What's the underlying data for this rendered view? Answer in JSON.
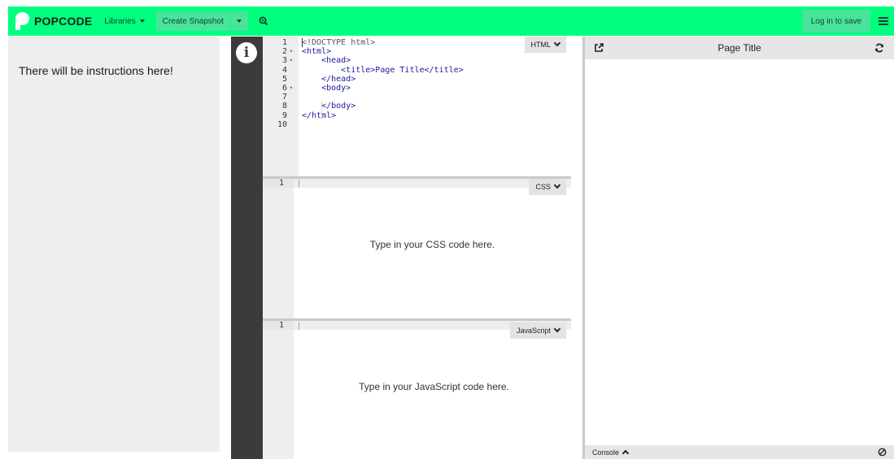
{
  "brand": {
    "name": "POPCODE",
    "accent": "#00ff7f"
  },
  "topbar": {
    "libraries_label": "Libraries",
    "snapshot_label": "Create Snapshot",
    "login_label": "Log in to save",
    "icons": [
      "chevron-down-icon",
      "search-icon",
      "hamburger-icon"
    ]
  },
  "instructions": {
    "text": "There will be instructions here!"
  },
  "info": {
    "glyph": "i"
  },
  "editors": {
    "html": {
      "language_label": "HTML",
      "line_numbers": [
        "1",
        "2",
        "3",
        "4",
        "5",
        "6",
        "7",
        "8",
        "9",
        "10"
      ],
      "fold_markers": [
        "",
        "▾",
        "▾",
        "",
        "",
        "▾",
        "",
        "",
        "",
        ""
      ],
      "code_lines": [
        "<!DOCTYPE html>",
        "<html>",
        "    <head>",
        "        <title>Page Title</title>",
        "    </head>",
        "    <body>",
        "",
        "    </body>",
        "</html>",
        ""
      ]
    },
    "css": {
      "language_label": "CSS",
      "line_number": "1",
      "placeholder": "Type in your CSS code here."
    },
    "javascript": {
      "language_label": "JavaScript",
      "line_number": "1",
      "placeholder": "Type in your JavaScript code here."
    }
  },
  "preview": {
    "title": "Page Title",
    "console_label": "Console"
  }
}
